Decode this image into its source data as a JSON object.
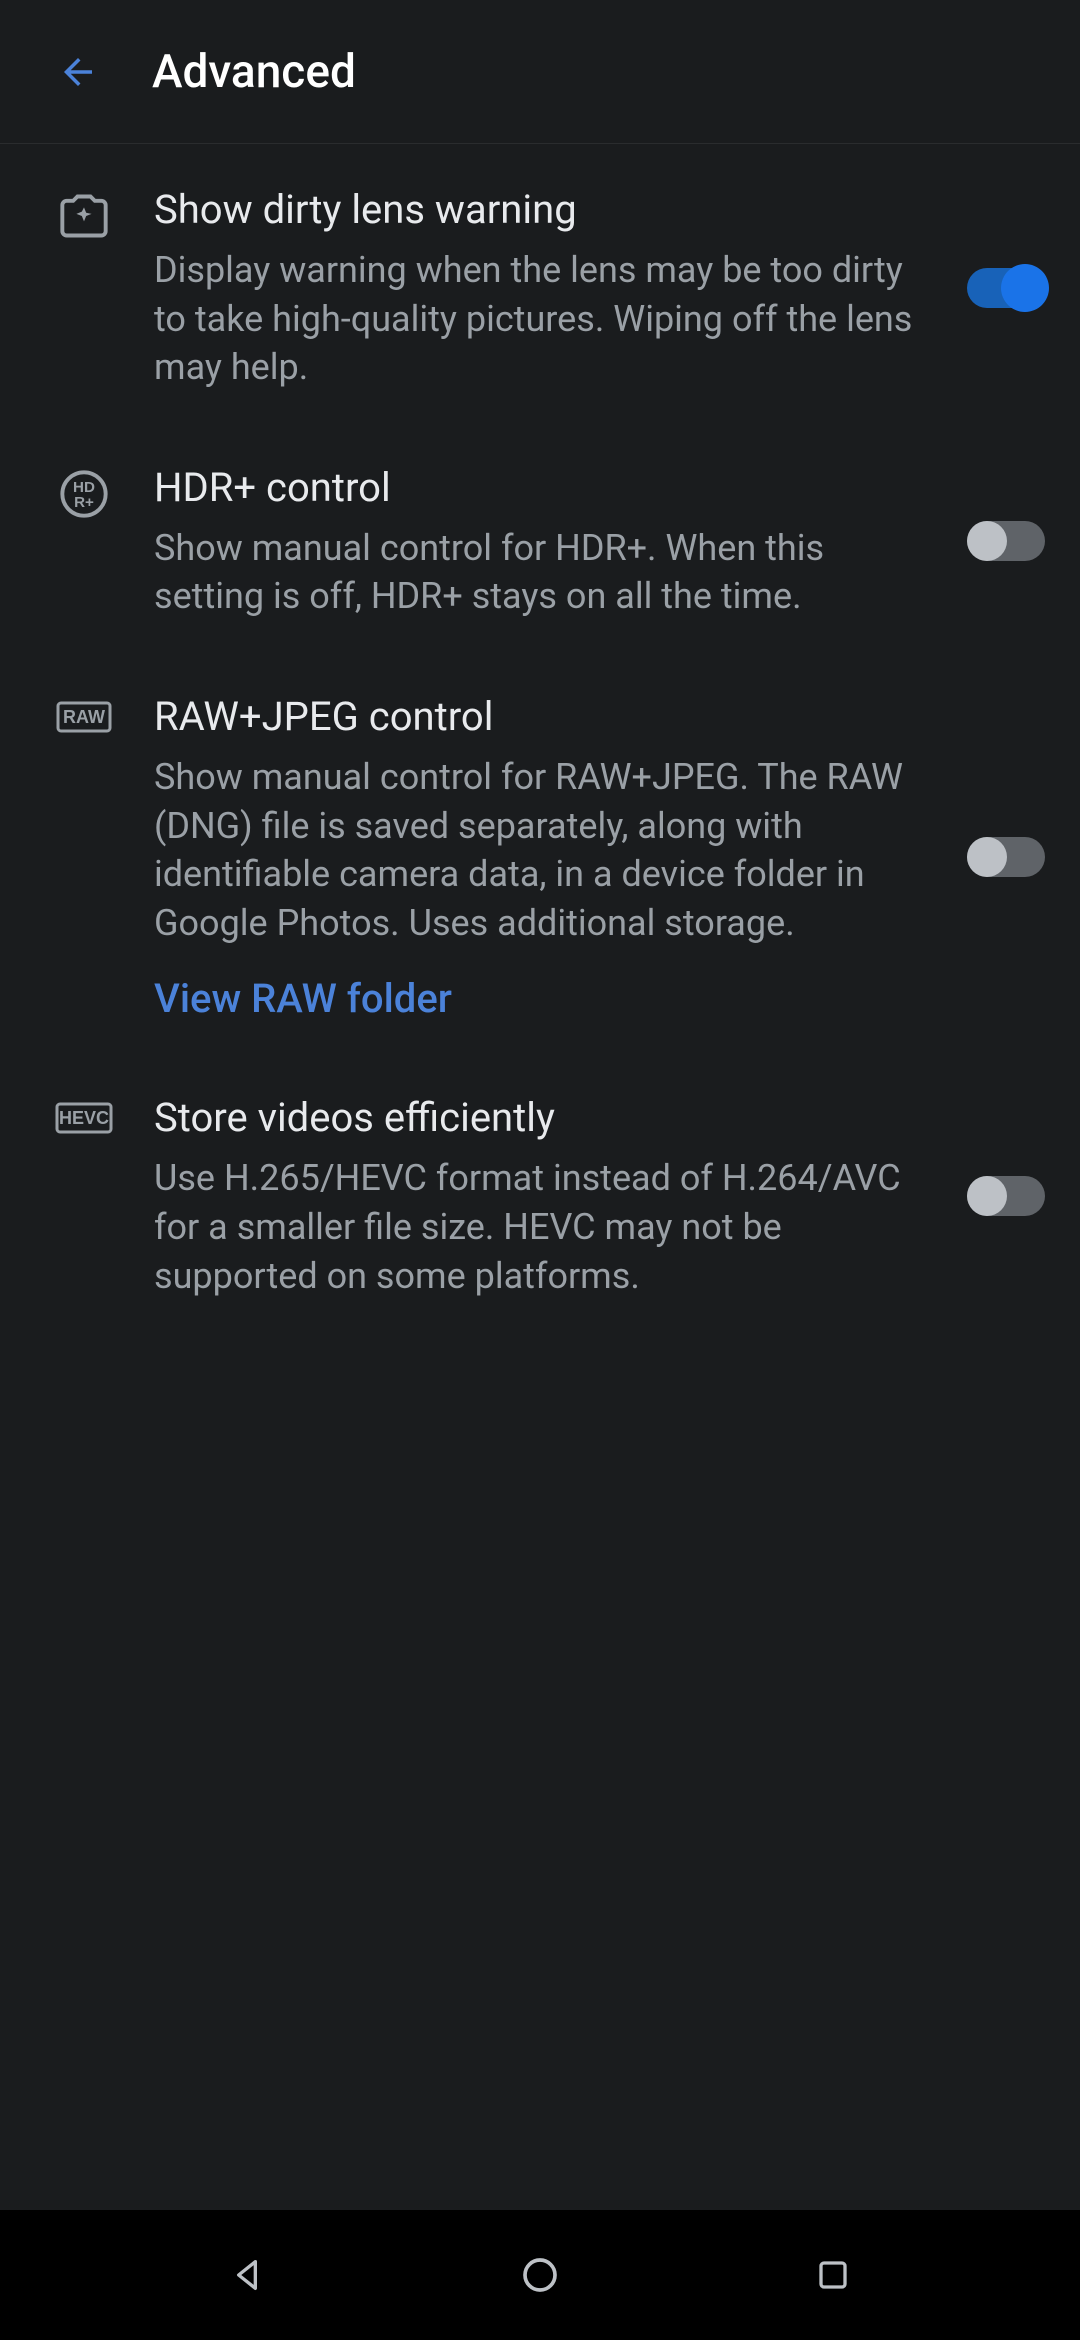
{
  "header": {
    "title": "Advanced"
  },
  "settings": [
    {
      "title": "Show dirty lens warning",
      "description": "Display warning when the lens may be too dirty to take high-quality pictures. Wiping off the lens may help.",
      "enabled": true
    },
    {
      "title": "HDR+ control",
      "description": "Show manual control for HDR+. When this setting is off, HDR+ stays on all the time.",
      "enabled": false
    },
    {
      "title": "RAW+JPEG control",
      "description": "Show manual control for RAW+JPEG. The RAW (DNG) file is saved separately, along with identifiable camera data, in a device folder in Google Photos. Uses additional storage.",
      "link": "View RAW folder",
      "enabled": false
    },
    {
      "title": "Store videos efficiently",
      "description": "Use H.265/HEVC format instead of H.264/AVC for a smaller file size. HEVC may not be supported on some platforms.",
      "enabled": false
    }
  ]
}
